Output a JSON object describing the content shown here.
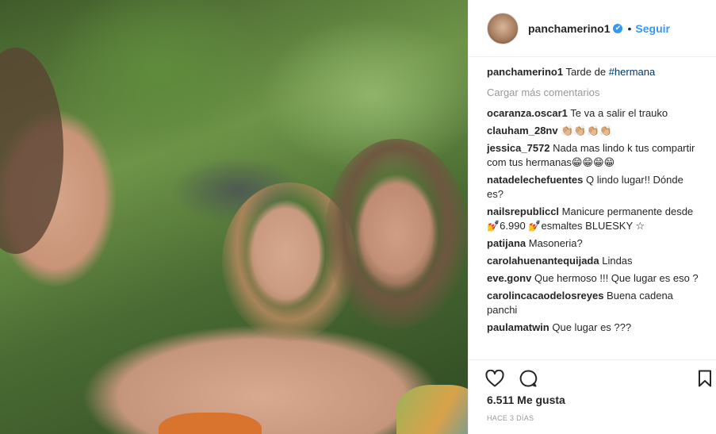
{
  "photo": {
    "alt": ""
  },
  "header": {
    "username": "panchamerino1",
    "verified_mark": "✔",
    "separator": "•",
    "follow_label": "Seguir"
  },
  "caption": {
    "username": "panchamerino1",
    "text": "Tarde de ",
    "hashtag": "#hermana"
  },
  "load_more": "Cargar más comentarios",
  "comments": [
    {
      "user": "ocaranza.oscar1",
      "text": "Te va a salir el trauko"
    },
    {
      "user": "clauham_28nv",
      "text": "👏🏼👏🏼👏🏼👏🏼"
    },
    {
      "user": "jessica_7572",
      "text": "Nada mas lindo k tus compartir com tus hermanas😁😁😁😁"
    },
    {
      "user": "natadelechefuentes",
      "text": "Q lindo lugar!! Dónde es?"
    },
    {
      "user": "nailsrepublіccl",
      "text": "Manicure permanente desde 💅6.990 💅esmaltes BLUESKY ☆"
    },
    {
      "user": "patijana",
      "text": "Masoneria?"
    },
    {
      "user": "carolahuenantequijada",
      "text": "Lindas"
    },
    {
      "user": "eve.gonv",
      "text": "Que hermoso !!! Que lugar es eso ?"
    },
    {
      "user": "carolincacaodelosreyes",
      "text": "Buena cadena panchi"
    },
    {
      "user": "paulamatwin",
      "text": "Que lugar es ???"
    }
  ],
  "actions": {
    "like_icon": "heart-outline-icon",
    "comment_icon": "comment-bubble-icon",
    "save_icon": "bookmark-icon"
  },
  "likes": "6.511 Me gusta",
  "time": "HACE 3 DÍAS",
  "colors": {
    "link_blue": "#3897f0",
    "text": "#262626",
    "muted": "#999999",
    "border": "#efefef"
  }
}
